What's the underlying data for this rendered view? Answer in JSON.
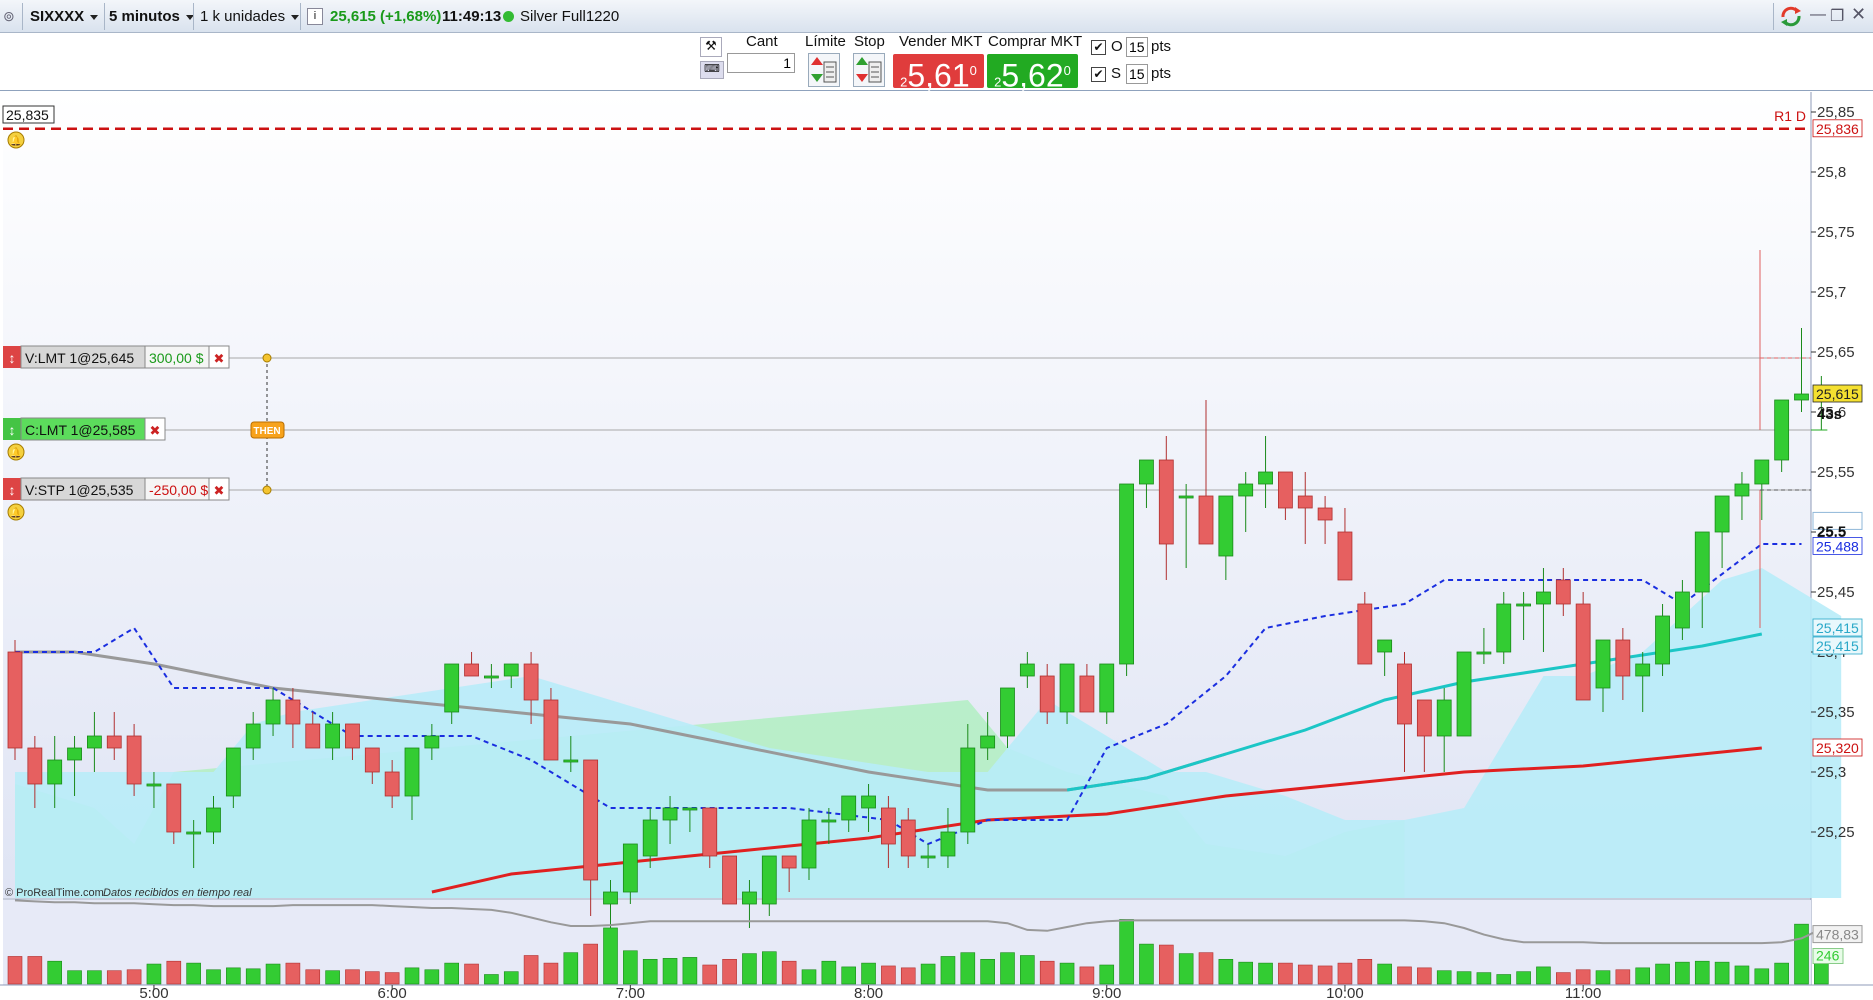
{
  "titlebar": {
    "symbol": "SIXXXX",
    "timeframe": "5 minutos",
    "units": "1 k unidades",
    "quote": "25,615 (+1,68%)",
    "time": "11:49:13",
    "instrument": "Silver Full1220"
  },
  "toolbar": {
    "qty_label": "Cant",
    "qty_value": "1",
    "limit_label": "Límite",
    "stop_label": "Stop",
    "sell_label": "Vender MKT",
    "buy_label": "Comprar MKT",
    "sell_price_small": "2",
    "sell_price_big": "5,61",
    "sell_price_sup": "0",
    "buy_price_small": "2",
    "buy_price_big": "5,62",
    "buy_price_sup": "0",
    "o_label": "O",
    "o_value": "15",
    "s_label": "S",
    "s_value": "15",
    "pts_label": "pts"
  },
  "colors": {
    "bull": "#33cc33",
    "bear": "#e66060",
    "cloud_blue": "#b8ecf8",
    "cloud_green": "#b4eec4",
    "ma_gray": "#999999",
    "ma_cyan": "#1cc6c6",
    "ma_red": "#e02020",
    "kijun": "#1a2ee0"
  },
  "chart_data": [
    {
      "type": "candlestick",
      "title": "",
      "x_ticks": [
        "5:00",
        "6:00",
        "7:00",
        "8:00",
        "9:00",
        "10:00",
        "11:00"
      ],
      "y_ticks": [
        "25,85",
        "25,8",
        "25,75",
        "25,7",
        "25,65",
        "25,6",
        "25,55",
        "25,5",
        "25,45",
        "25,4",
        "25,35",
        "25,3",
        "25,25"
      ],
      "ylim": [
        25.2,
        25.86
      ],
      "bar_interval_minutes": 5,
      "first_bar_time": "4:25",
      "candles": [
        [
          25.4,
          25.41,
          25.31,
          25.32
        ],
        [
          25.32,
          25.33,
          25.27,
          25.29
        ],
        [
          25.29,
          25.33,
          25.27,
          25.31
        ],
        [
          25.31,
          25.33,
          25.28,
          25.32
        ],
        [
          25.32,
          25.35,
          25.3,
          25.33
        ],
        [
          25.33,
          25.35,
          25.31,
          25.32
        ],
        [
          25.33,
          25.34,
          25.28,
          25.29
        ],
        [
          25.29,
          25.3,
          25.27,
          25.29
        ],
        [
          25.29,
          25.29,
          25.24,
          25.25
        ],
        [
          25.25,
          25.26,
          25.22,
          25.25
        ],
        [
          25.25,
          25.28,
          25.24,
          25.27
        ],
        [
          25.28,
          25.32,
          25.27,
          25.32
        ],
        [
          25.32,
          25.35,
          25.31,
          25.34
        ],
        [
          25.34,
          25.37,
          25.33,
          25.36
        ],
        [
          25.36,
          25.37,
          25.32,
          25.34
        ],
        [
          25.34,
          25.35,
          25.32,
          25.32
        ],
        [
          25.32,
          25.35,
          25.31,
          25.34
        ],
        [
          25.34,
          25.34,
          25.31,
          25.32
        ],
        [
          25.32,
          25.32,
          25.29,
          25.3
        ],
        [
          25.3,
          25.31,
          25.27,
          25.28
        ],
        [
          25.28,
          25.32,
          25.26,
          25.32
        ],
        [
          25.32,
          25.34,
          25.31,
          25.33
        ],
        [
          25.35,
          25.39,
          25.34,
          25.39
        ],
        [
          25.39,
          25.4,
          25.38,
          25.38
        ],
        [
          25.38,
          25.39,
          25.37,
          25.38
        ],
        [
          25.38,
          25.39,
          25.37,
          25.39
        ],
        [
          25.39,
          25.4,
          25.34,
          25.36
        ],
        [
          25.36,
          25.37,
          25.32,
          25.31
        ],
        [
          25.31,
          25.33,
          25.3,
          25.31
        ],
        [
          25.31,
          25.31,
          25.18,
          25.21
        ],
        [
          25.19,
          25.21,
          25.17,
          25.2
        ],
        [
          25.2,
          25.24,
          25.19,
          25.24
        ],
        [
          25.23,
          25.27,
          25.22,
          25.26
        ],
        [
          25.26,
          25.28,
          25.24,
          25.27
        ],
        [
          25.27,
          25.27,
          25.25,
          25.27
        ],
        [
          25.27,
          25.27,
          25.22,
          25.23
        ],
        [
          25.23,
          25.23,
          25.19,
          25.19
        ],
        [
          25.19,
          25.21,
          25.17,
          25.2
        ],
        [
          25.19,
          25.23,
          25.18,
          25.23
        ],
        [
          25.23,
          25.23,
          25.2,
          25.22
        ],
        [
          25.22,
          25.27,
          25.21,
          25.26
        ],
        [
          25.26,
          25.27,
          25.24,
          25.26
        ],
        [
          25.26,
          25.28,
          25.25,
          25.28
        ],
        [
          25.27,
          25.29,
          25.25,
          25.28
        ],
        [
          25.27,
          25.28,
          25.22,
          25.24
        ],
        [
          25.26,
          25.27,
          25.22,
          25.23
        ],
        [
          25.23,
          25.24,
          25.22,
          25.23
        ],
        [
          25.23,
          25.27,
          25.22,
          25.25
        ],
        [
          25.25,
          25.34,
          25.24,
          25.32
        ],
        [
          25.32,
          25.35,
          25.31,
          25.33
        ],
        [
          25.33,
          25.37,
          25.32,
          25.37
        ],
        [
          25.38,
          25.4,
          25.37,
          25.39
        ],
        [
          25.38,
          25.39,
          25.34,
          25.35
        ],
        [
          25.35,
          25.39,
          25.34,
          25.39
        ],
        [
          25.38,
          25.39,
          25.35,
          25.35
        ],
        [
          25.35,
          25.39,
          25.34,
          25.39
        ],
        [
          25.39,
          25.4,
          25.38,
          25.54
        ],
        [
          25.54,
          25.56,
          25.52,
          25.56
        ],
        [
          25.56,
          25.58,
          25.46,
          25.49
        ],
        [
          25.53,
          25.54,
          25.47,
          25.53
        ],
        [
          25.53,
          25.61,
          25.49,
          25.49
        ],
        [
          25.48,
          25.53,
          25.46,
          25.53
        ],
        [
          25.53,
          25.55,
          25.5,
          25.54
        ],
        [
          25.54,
          25.58,
          25.52,
          25.55
        ],
        [
          25.55,
          25.54,
          25.51,
          25.52
        ],
        [
          25.53,
          25.55,
          25.49,
          25.52
        ],
        [
          25.52,
          25.53,
          25.49,
          25.51
        ],
        [
          25.5,
          25.52,
          25.46,
          25.46
        ],
        [
          25.44,
          25.45,
          25.39,
          25.39
        ],
        [
          25.4,
          25.41,
          25.38,
          25.41
        ],
        [
          25.39,
          25.4,
          25.3,
          25.34
        ],
        [
          25.36,
          25.36,
          25.3,
          25.33
        ],
        [
          25.33,
          25.37,
          25.3,
          25.36
        ],
        [
          25.33,
          25.4,
          25.33,
          25.4
        ],
        [
          25.4,
          25.42,
          25.39,
          25.4
        ],
        [
          25.4,
          25.45,
          25.39,
          25.44
        ],
        [
          25.44,
          25.45,
          25.41,
          25.44
        ],
        [
          25.44,
          25.47,
          25.4,
          25.45
        ],
        [
          25.46,
          25.47,
          25.43,
          25.44
        ],
        [
          25.44,
          25.45,
          25.36,
          25.36
        ],
        [
          25.37,
          25.41,
          25.35,
          25.41
        ],
        [
          25.41,
          25.42,
          25.36,
          25.38
        ],
        [
          25.38,
          25.4,
          25.35,
          25.39
        ],
        [
          25.39,
          25.44,
          25.38,
          25.43
        ],
        [
          25.42,
          25.46,
          25.41,
          25.45
        ],
        [
          25.45,
          25.5,
          25.42,
          25.5
        ],
        [
          25.5,
          25.53,
          25.47,
          25.53
        ],
        [
          25.53,
          25.55,
          25.51,
          25.54
        ],
        [
          25.54,
          25.55,
          25.51,
          25.56
        ],
        [
          25.56,
          25.61,
          25.55,
          25.61
        ],
        [
          25.61,
          25.67,
          25.6,
          25.615
        ],
        [
          25.615,
          25.63,
          25.585,
          25.615
        ]
      ]
    },
    {
      "type": "line",
      "title": "Volume",
      "volume_label": "478,83",
      "volume_ma_label": "246",
      "values": [
        29,
        29,
        24,
        14,
        14,
        14,
        15,
        21,
        24,
        22,
        15,
        17,
        16,
        21,
        22,
        15,
        14,
        15,
        13,
        12,
        17,
        15,
        22,
        21,
        10,
        13,
        30,
        22,
        33,
        42,
        59,
        35,
        26,
        27,
        28,
        20,
        26,
        32,
        34,
        24,
        15,
        24,
        18,
        22,
        19,
        17,
        21,
        29,
        33,
        26,
        33,
        30,
        24,
        22,
        18,
        20,
        68,
        42,
        41,
        32,
        33,
        26,
        23,
        22,
        22,
        20,
        19,
        22,
        26,
        21,
        18,
        17,
        14,
        13,
        12,
        10,
        13,
        18,
        12,
        15,
        14,
        15,
        17,
        21,
        23,
        24,
        23,
        19,
        16,
        22,
        63,
        25
      ],
      "ma_values": [
        88,
        87,
        86,
        86,
        85,
        85,
        85,
        84,
        83,
        83,
        82,
        82,
        82,
        82,
        83,
        83,
        83,
        83,
        83,
        82,
        81,
        80,
        80,
        79,
        78,
        75,
        70,
        65,
        61,
        61,
        62,
        64,
        66,
        66,
        66,
        66,
        66,
        66,
        66,
        66,
        66,
        66,
        66,
        66,
        66,
        66,
        66,
        66,
        66,
        66,
        64,
        57,
        56,
        60,
        64,
        66,
        67,
        67,
        67,
        67,
        67,
        67,
        67,
        67,
        67,
        67,
        67,
        67,
        67,
        67,
        67,
        66,
        64,
        59,
        52,
        47,
        44,
        44,
        44,
        44,
        43,
        43,
        43,
        43,
        43,
        43,
        43,
        43,
        43,
        44,
        48,
        58
      ]
    }
  ],
  "indicators": {
    "ma_gray": [
      [
        0,
        25.4
      ],
      [
        3,
        25.4
      ],
      [
        7,
        25.39
      ],
      [
        13,
        25.37
      ],
      [
        19,
        25.36
      ],
      [
        25,
        25.35
      ],
      [
        31,
        25.34
      ],
      [
        37,
        25.32
      ],
      [
        43,
        25.3
      ],
      [
        49,
        25.285
      ],
      [
        53,
        25.285
      ],
      [
        57,
        25.295
      ],
      [
        61,
        25.315
      ]
    ],
    "ma_cyan": [
      [
        53,
        25.285
      ],
      [
        57,
        25.295
      ],
      [
        61,
        25.315
      ],
      [
        65,
        25.335
      ],
      [
        69,
        25.36
      ],
      [
        73,
        25.375
      ],
      [
        77,
        25.385
      ],
      [
        81,
        25.395
      ],
      [
        85,
        25.405
      ],
      [
        88,
        25.415
      ]
    ],
    "ma_red": [
      [
        21,
        25.2
      ],
      [
        25,
        25.215
      ],
      [
        31,
        25.225
      ],
      [
        37,
        25.235
      ],
      [
        43,
        25.245
      ],
      [
        49,
        25.26
      ],
      [
        55,
        25.265
      ],
      [
        61,
        25.28
      ],
      [
        67,
        25.29
      ],
      [
        73,
        25.3
      ],
      [
        79,
        25.305
      ],
      [
        85,
        25.315
      ],
      [
        88,
        25.32
      ]
    ],
    "kijun": [
      [
        0,
        25.4
      ],
      [
        4,
        25.4
      ],
      [
        6,
        25.42
      ],
      [
        8,
        25.37
      ],
      [
        13,
        25.37
      ],
      [
        17,
        25.33
      ],
      [
        23,
        25.33
      ],
      [
        26,
        25.31
      ],
      [
        28,
        25.29
      ],
      [
        30,
        25.27
      ],
      [
        39,
        25.27
      ],
      [
        44,
        25.26
      ],
      [
        46,
        25.24
      ],
      [
        49,
        25.26
      ],
      [
        53,
        25.26
      ],
      [
        55,
        25.32
      ],
      [
        58,
        25.34
      ],
      [
        61,
        25.38
      ],
      [
        63,
        25.42
      ],
      [
        66,
        25.43
      ],
      [
        70,
        25.44
      ],
      [
        72,
        25.46
      ],
      [
        82,
        25.46
      ],
      [
        84,
        25.44
      ],
      [
        88,
        25.49
      ],
      [
        90,
        25.49
      ]
    ],
    "cloud_blue": [
      [
        0,
        25.3
      ],
      [
        8,
        25.3
      ],
      [
        10,
        25.3
      ],
      [
        12,
        25.34
      ],
      [
        14,
        25.35
      ],
      [
        18,
        25.36
      ],
      [
        22,
        25.37
      ],
      [
        26,
        25.38
      ],
      [
        28,
        25.37
      ],
      [
        30,
        25.36
      ],
      [
        34,
        25.34
      ],
      [
        38,
        25.32
      ],
      [
        42,
        25.31
      ],
      [
        46,
        25.3
      ],
      [
        49,
        25.3
      ],
      [
        52,
        25.36
      ],
      [
        56,
        25.32
      ],
      [
        58,
        25.3
      ],
      [
        60,
        25.3
      ],
      [
        64,
        25.28
      ],
      [
        67,
        25.26
      ],
      [
        70,
        25.26
      ],
      [
        73,
        25.27
      ],
      [
        77,
        25.38
      ],
      [
        79,
        25.38
      ],
      [
        82,
        25.4
      ],
      [
        86,
        25.46
      ],
      [
        88,
        25.47
      ],
      [
        90,
        25.45
      ],
      [
        92,
        25.43
      ]
    ],
    "cloud_green": [
      [
        0,
        25.29
      ],
      [
        4,
        25.27
      ],
      [
        6,
        25.24
      ],
      [
        8,
        25.3
      ],
      [
        48,
        25.36
      ],
      [
        50,
        25.32
      ],
      [
        53,
        25.3
      ],
      [
        58,
        25.28
      ],
      [
        60,
        25.24
      ],
      [
        64,
        25.23
      ],
      [
        67,
        25.25
      ],
      [
        70,
        25.26
      ]
    ]
  },
  "price_labels": {
    "r1_label": "R1 D",
    "r1_value": "25,836",
    "left_price": "25,835",
    "current_price": "25,615",
    "countdown": "43s",
    "kijun_value": "25,488",
    "cloud_value_1": "25,415",
    "cloud_value_2": "25,415",
    "ma_red_value": "25,320",
    "mid_tick": "25.5"
  },
  "orders": [
    {
      "label": "V:LMT 1@25,645",
      "pnl": "300,00 $",
      "price": 25.645,
      "side": "sell"
    },
    {
      "label": "C:LMT 1@25,585",
      "pnl": "",
      "price": 25.585,
      "side": "buy"
    },
    {
      "label": "V:STP 1@25,535",
      "pnl": "-250,00 $",
      "price": 25.535,
      "side": "sell"
    }
  ],
  "then_label": "THEN",
  "footer": {
    "brand": "© ProRealTime.com",
    "note": "Datos recibidos en tiempo real"
  }
}
